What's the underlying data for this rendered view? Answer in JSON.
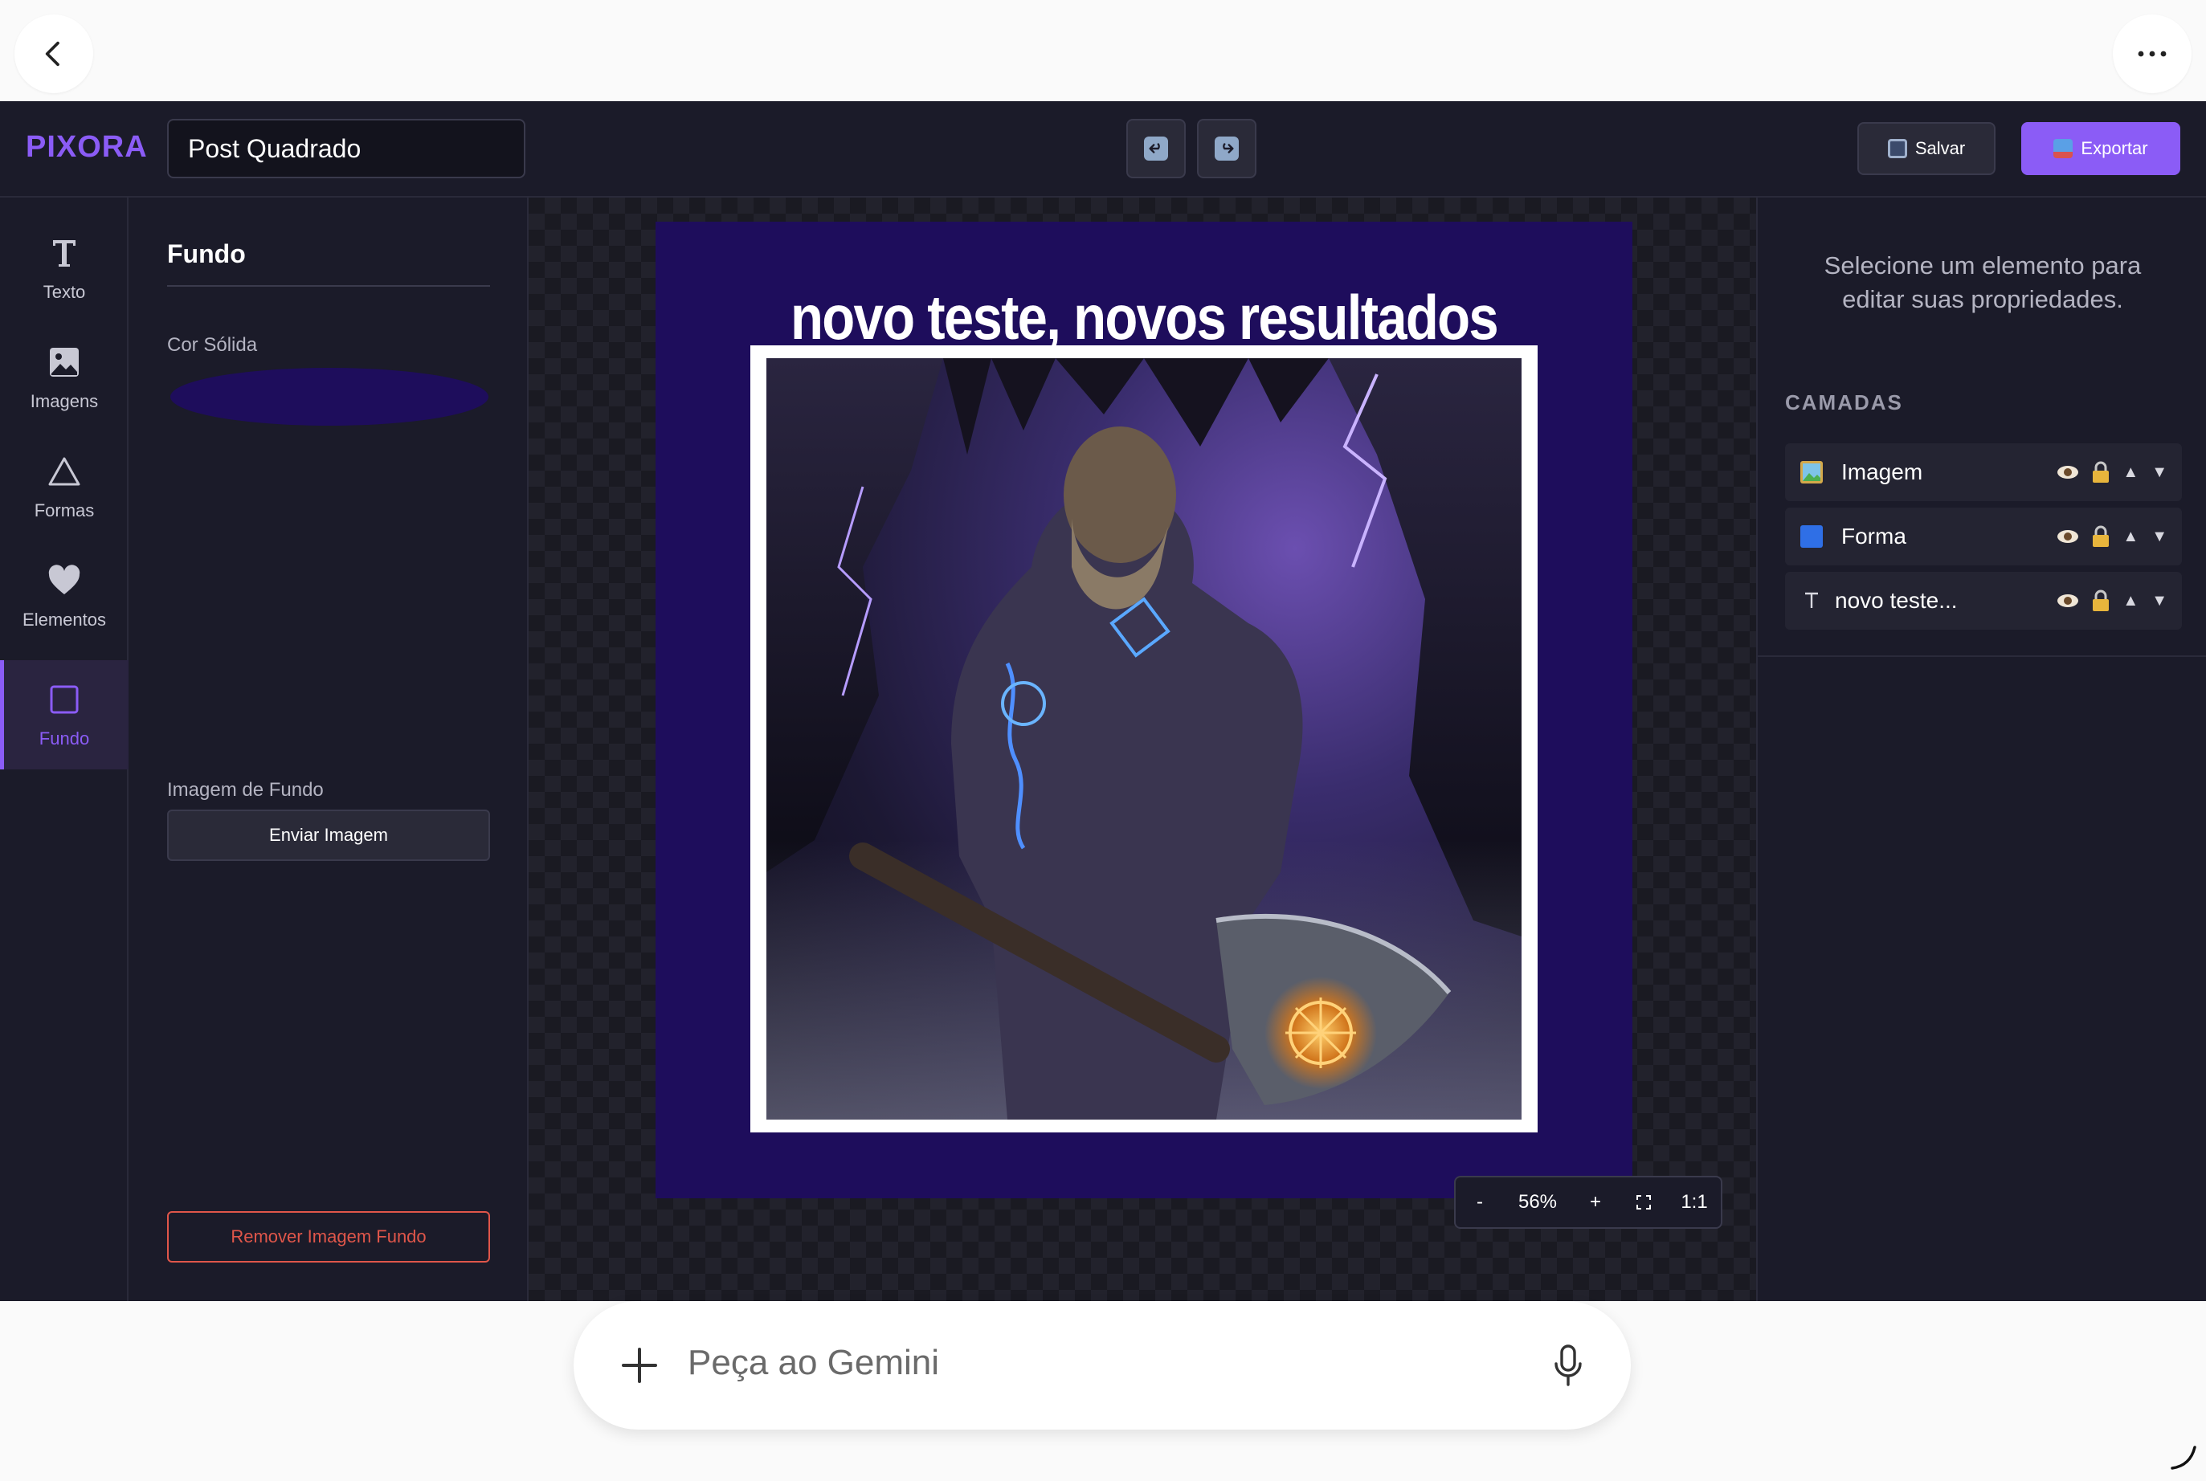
{
  "header": {
    "logo": "PIXORA",
    "title_value": "Post Quadrado",
    "save_label": "Salvar",
    "export_label": "Exportar"
  },
  "rail": {
    "items": [
      {
        "label": "Texto",
        "icon": "text-icon"
      },
      {
        "label": "Imagens",
        "icon": "image-icon"
      },
      {
        "label": "Formas",
        "icon": "triangle-icon"
      },
      {
        "label": "Elementos",
        "icon": "heart-icon"
      },
      {
        "label": "Fundo",
        "icon": "square-icon",
        "active": true
      }
    ]
  },
  "props": {
    "title": "Fundo",
    "solid_label": "Cor Sólida",
    "solid_color": "#1e0d5c",
    "bg_image_label": "Imagem de Fundo",
    "upload_label": "Enviar Imagem",
    "remove_label": "Remover Imagem Fundo"
  },
  "canvas": {
    "headline": "novo teste, novos resultados",
    "zoom": {
      "minus": "-",
      "value": "56%",
      "plus": "+",
      "ratio": "1:1"
    }
  },
  "right": {
    "hint": "Selecione um elemento para editar suas propriedades.",
    "layers_title": "CAMADAS",
    "layers": [
      {
        "name": "Imagem",
        "icon": "image-layer-icon"
      },
      {
        "name": "Forma",
        "icon": "shape-layer-icon"
      },
      {
        "name": "novo teste...",
        "icon": "text-layer-icon"
      }
    ],
    "layer_controls": {
      "up": "▲",
      "down": "▼"
    }
  },
  "gemini": {
    "placeholder": "Peça ao Gemini"
  },
  "colors": {
    "accent": "#8b5cf6",
    "panel": "#1b1b29",
    "danger": "#e0564a",
    "artboard": "#1e0d5c"
  }
}
